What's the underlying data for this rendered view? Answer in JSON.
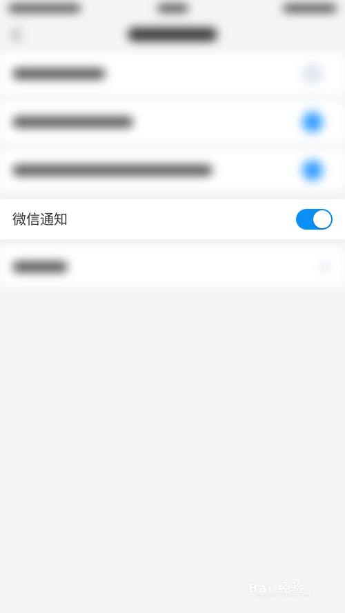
{
  "settings": {
    "wechat_notification": {
      "label": "微信通知",
      "enabled": true
    }
  },
  "colors": {
    "background": "#f4f5f7",
    "row_background": "#ffffff",
    "toggle_on": "#0a8ff5",
    "label_text": "#333333"
  },
  "watermark": {
    "text": "Bai 经验",
    "url": "jingyan.baidu.com"
  }
}
